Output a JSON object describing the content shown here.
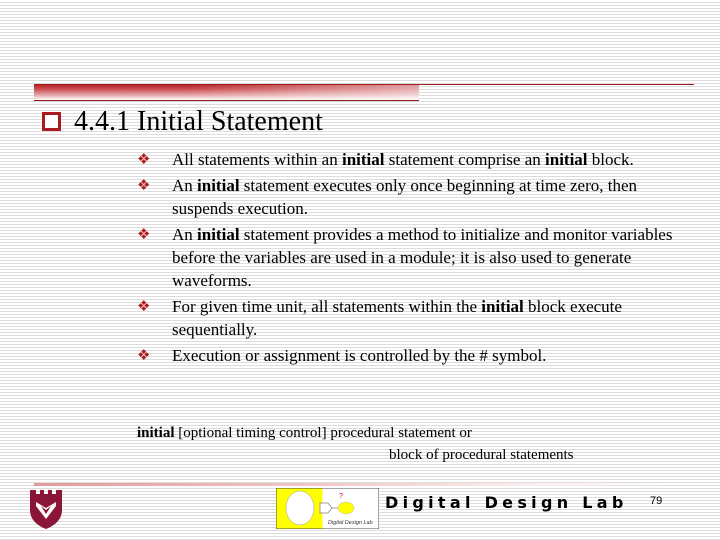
{
  "slide": {
    "title": "4.4.1 Initial Statement",
    "bullet_icon": "diamond-bullet-icon",
    "bullets": [
      {
        "segments": [
          {
            "text": "All statements within an ",
            "bold": false
          },
          {
            "text": "initial",
            "bold": true
          },
          {
            "text": " statement comprise an ",
            "bold": false
          },
          {
            "text": "initial",
            "bold": true
          },
          {
            "text": " block.",
            "bold": false
          }
        ]
      },
      {
        "segments": [
          {
            "text": "An ",
            "bold": false
          },
          {
            "text": "initial",
            "bold": true
          },
          {
            "text": " statement executes only once beginning at time zero, then suspends execution.",
            "bold": false
          }
        ]
      },
      {
        "segments": [
          {
            "text": "An ",
            "bold": false
          },
          {
            "text": "initial",
            "bold": true
          },
          {
            "text": " statement provides a method to initialize and monitor variables before the variables are used in a module; it is also used to generate waveforms.",
            "bold": false
          }
        ]
      },
      {
        "segments": [
          {
            "text": "For given time unit, all statements within the ",
            "bold": false
          },
          {
            "text": "initial",
            "bold": true
          },
          {
            "text": " block execute sequentially.",
            "bold": false
          }
        ]
      },
      {
        "segments": [
          {
            "text": "Execution or assignment is controlled by the # symbol.",
            "bold": false
          }
        ]
      }
    ],
    "syntax": {
      "keyword": "initial",
      "line1_rest": " [optional timing control] procedural statement or",
      "line2": "block of procedural statements"
    }
  },
  "footer": {
    "lab_name": "Digital Design Lab",
    "logo_caption": "Digital Design Lab",
    "logo_mark": "?",
    "page_number": "79"
  },
  "colors": {
    "accent": "#b01e23",
    "crest": "#8b1538",
    "logo_yellow": "#ffff00"
  }
}
